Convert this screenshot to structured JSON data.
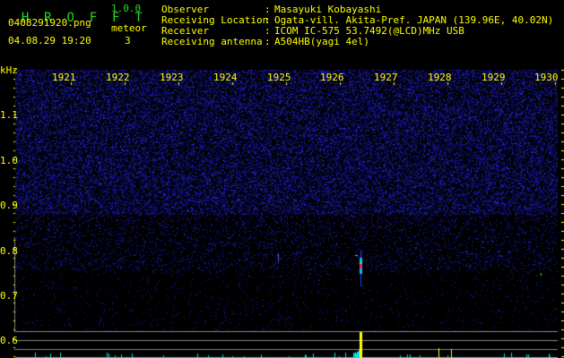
{
  "app": {
    "name_letters": [
      "H",
      "R",
      "O",
      "F",
      "F",
      "T"
    ],
    "version": "1.0.0"
  },
  "file": {
    "name": "0408291920.png",
    "datetime": "04.08.29 19:20"
  },
  "meteor": {
    "label": "meteor",
    "count": "3"
  },
  "info": [
    {
      "label": "Observer",
      "sep": ":",
      "value": "Masayuki Kobayashi"
    },
    {
      "label": "Receiving Location",
      "sep": ":",
      "value": "Ogata-vill. Akita-Pref. JAPAN (139.96E, 40.02N)"
    },
    {
      "label": "Receiver",
      "sep": ":",
      "value": "ICOM IC-575 53.7492(@LCD)MHz USB"
    },
    {
      "label": "Receiving antenna",
      "sep": ":",
      "value": "A504HB(yagi 4el)"
    }
  ],
  "axis": {
    "y_unit": "kHz",
    "y_ticks": [
      "1.1",
      "1.0",
      "0.9",
      "0.8",
      "0.7",
      "0.6"
    ],
    "x_ticks": [
      "1921",
      "1922",
      "1923",
      "1924",
      "1925",
      "1926",
      "1927",
      "1928",
      "1929",
      "1930"
    ]
  },
  "colors": {
    "text": "#ffff00",
    "logo": "#22dd22",
    "noise": "#1a1aa0",
    "histogram": "#00e5e5",
    "meteor_peak": "#ffff00"
  }
}
